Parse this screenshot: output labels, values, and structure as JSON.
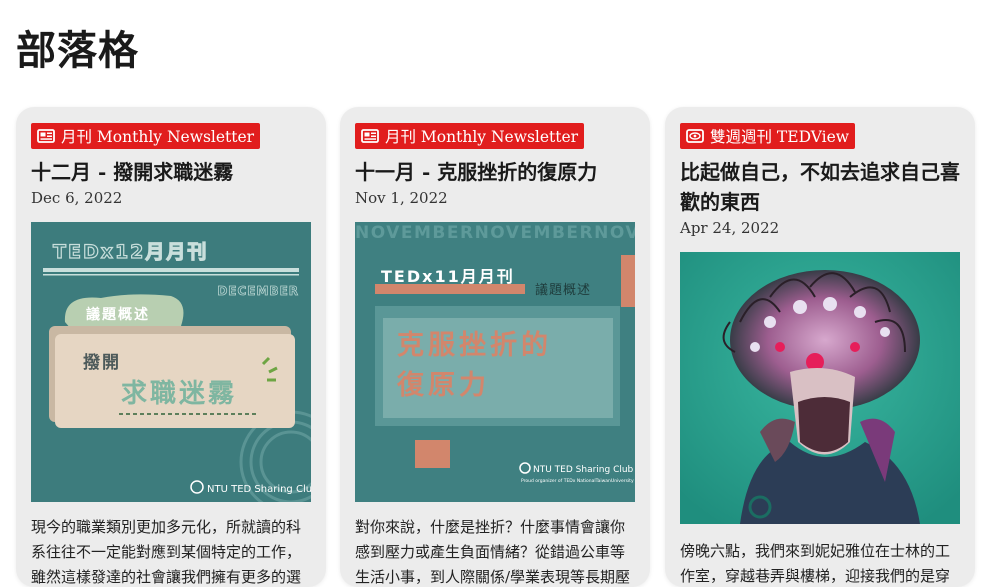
{
  "page": {
    "title": "部落格"
  },
  "posts": [
    {
      "category": "月刊 Monthly Newsletter",
      "category_icon": "newspaper-icon",
      "title": "十二月 - 撥開求職迷霧",
      "date": "Dec 6, 2022",
      "image": {
        "heading": "TEDx12月月刊",
        "month": "DECEMBER",
        "tag": "議題概述",
        "line1": "撥開",
        "line2": "求職迷霧",
        "club": "NTU TED Sharing Club"
      },
      "excerpt": "現今的職業類別更加多元化，所就讀的科系往往不一定能對應到某個特定的工作，雖然這樣發達的社會讓我們擁有更多的選"
    },
    {
      "category": "月刊 Monthly Newsletter",
      "category_icon": "newspaper-icon",
      "title": "十一月 - 克服挫折的復原力",
      "date": "Nov 1, 2022",
      "image": {
        "banner": "NOVEMBERNOVEMBERNOV",
        "heading": "TEDx11月月刊",
        "tag": "議題概述",
        "line1": "克服挫折的",
        "line2": "復原力",
        "club": "NTU TED Sharing Club",
        "subclub": "Proud organizer of TEDx NationalTaiwanUniversity"
      },
      "excerpt": "對你來說，什麼是挫折？什麼事情會讓你感到壓力或產生負面情緒？從錯過公車等生活小事，到人際關係/學業表現等長期壓"
    },
    {
      "category": "雙週週刊 TEDView",
      "category_icon": "eye-icon",
      "title": "比起做自己，不如去追求自己喜歡的東西",
      "date": "Apr 24, 2022",
      "excerpt": "傍晚六點，我們來到妮妃雅位在士林的工作室，穿越巷弄與樓梯，迎接我們的是穿"
    }
  ],
  "colors": {
    "badge": "#e11d1d",
    "card_bg": "#ececec",
    "teal": "#3f7f80",
    "salmon": "#d2866c"
  }
}
